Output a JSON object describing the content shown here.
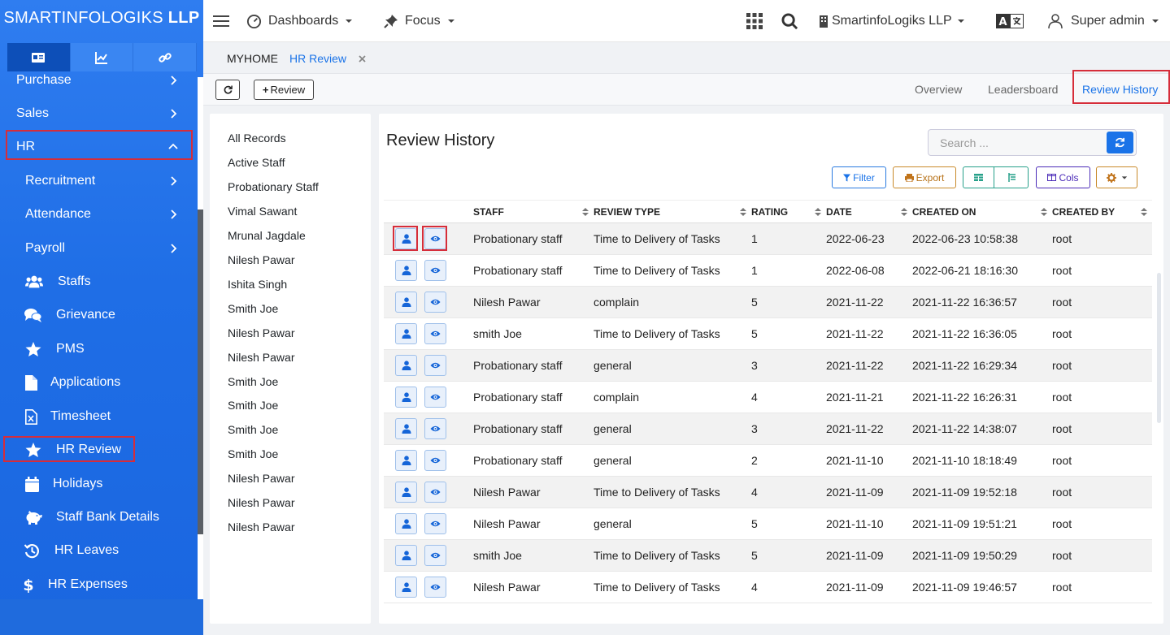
{
  "brand": {
    "prefix": "SMARTINFOLOGIKS",
    "suffix": "LLP"
  },
  "sidebar": {
    "menu": [
      {
        "label": "Purchase",
        "icon": "chevron-right-icon"
      },
      {
        "label": "Sales",
        "icon": "chevron-right-icon"
      },
      {
        "label": "HR",
        "icon": "chevron-up-icon"
      },
      {
        "label": "Recruitment",
        "icon": "chevron-right-icon"
      },
      {
        "label": "Attendance",
        "icon": "chevron-right-icon"
      },
      {
        "label": "Payroll",
        "icon": "chevron-right-icon"
      },
      {
        "label": "Staffs",
        "icon": "users-icon"
      },
      {
        "label": "Grievance",
        "icon": "comments-icon"
      },
      {
        "label": "PMS",
        "icon": "star-icon"
      },
      {
        "label": "Applications",
        "icon": "file-icon"
      },
      {
        "label": "Timesheet",
        "icon": "excel-file-icon"
      },
      {
        "label": "HR Review",
        "icon": "star-icon"
      },
      {
        "label": "Holidays",
        "icon": "calendar-icon"
      },
      {
        "label": "Staff Bank Details",
        "icon": "piggy-bank-icon"
      },
      {
        "label": "HR Leaves",
        "icon": "history-icon"
      },
      {
        "label": "HR Expenses",
        "icon": "dollar-icon"
      }
    ]
  },
  "topbar": {
    "dashboards": "Dashboards",
    "focus": "Focus",
    "company": "SmartinfoLogiks LLP",
    "user": "Super admin"
  },
  "breadcrumb": {
    "home": "MYHOME",
    "current": "HR Review"
  },
  "toolbar": {
    "add_label": "Review",
    "tabs": [
      "Overview",
      "Leadersboard",
      "Review History"
    ]
  },
  "leftpanel": {
    "items": [
      "All Records",
      "Active Staff",
      "Probationary Staff",
      "Vimal Sawant",
      "Mrunal Jagdale",
      "Nilesh Pawar",
      "Ishita Singh",
      "Smith Joe",
      "Nilesh Pawar",
      "Nilesh Pawar",
      "Smith Joe",
      "Smith Joe",
      "Smith Joe",
      "Smith Joe",
      "Nilesh Pawar",
      "Nilesh Pawar",
      "Nilesh Pawar"
    ]
  },
  "main": {
    "title": "Review History",
    "search_placeholder": "Search ...",
    "filter_label": "Filter",
    "export_label": "Export",
    "cols_label": "Cols",
    "columns": [
      "STAFF",
      "REVIEW TYPE",
      "RATING",
      "DATE",
      "CREATED ON",
      "CREATED BY"
    ],
    "rows": [
      [
        "Probationary staff",
        "Time to Delivery of Tasks",
        "1",
        "2022-06-23",
        "2022-06-23 10:58:38",
        "root"
      ],
      [
        "Probationary staff",
        "Time to Delivery of Tasks",
        "1",
        "2022-06-08",
        "2022-06-21 18:16:30",
        "root"
      ],
      [
        "Nilesh Pawar",
        "complain",
        "5",
        "2021-11-22",
        "2021-11-22 16:36:57",
        "root"
      ],
      [
        "smith Joe",
        "Time to Delivery of Tasks",
        "5",
        "2021-11-22",
        "2021-11-22 16:36:05",
        "root"
      ],
      [
        "Probationary staff",
        "general",
        "3",
        "2021-11-22",
        "2021-11-22 16:29:34",
        "root"
      ],
      [
        "Probationary staff",
        "complain",
        "4",
        "2021-11-21",
        "2021-11-22 16:26:31",
        "root"
      ],
      [
        "Probationary staff",
        "general",
        "3",
        "2021-11-22",
        "2021-11-22 14:38:07",
        "root"
      ],
      [
        "Probationary staff",
        "general",
        "2",
        "2021-11-10",
        "2021-11-10 18:18:49",
        "root"
      ],
      [
        "Nilesh Pawar",
        "Time to Delivery of Tasks",
        "4",
        "2021-11-09",
        "2021-11-09 19:52:18",
        "root"
      ],
      [
        "Nilesh Pawar",
        "general",
        "5",
        "2021-11-10",
        "2021-11-09 19:51:21",
        "root"
      ],
      [
        "smith Joe",
        "Time to Delivery of Tasks",
        "5",
        "2021-11-09",
        "2021-11-09 19:50:29",
        "root"
      ],
      [
        "Nilesh Pawar",
        "Time to Delivery of Tasks",
        "4",
        "2021-11-09",
        "2021-11-09 19:46:57",
        "root"
      ]
    ]
  },
  "colors": {
    "accent": "#1a73e8",
    "sidebar": "#1f6ee6",
    "highlight": "#d62d3a"
  }
}
